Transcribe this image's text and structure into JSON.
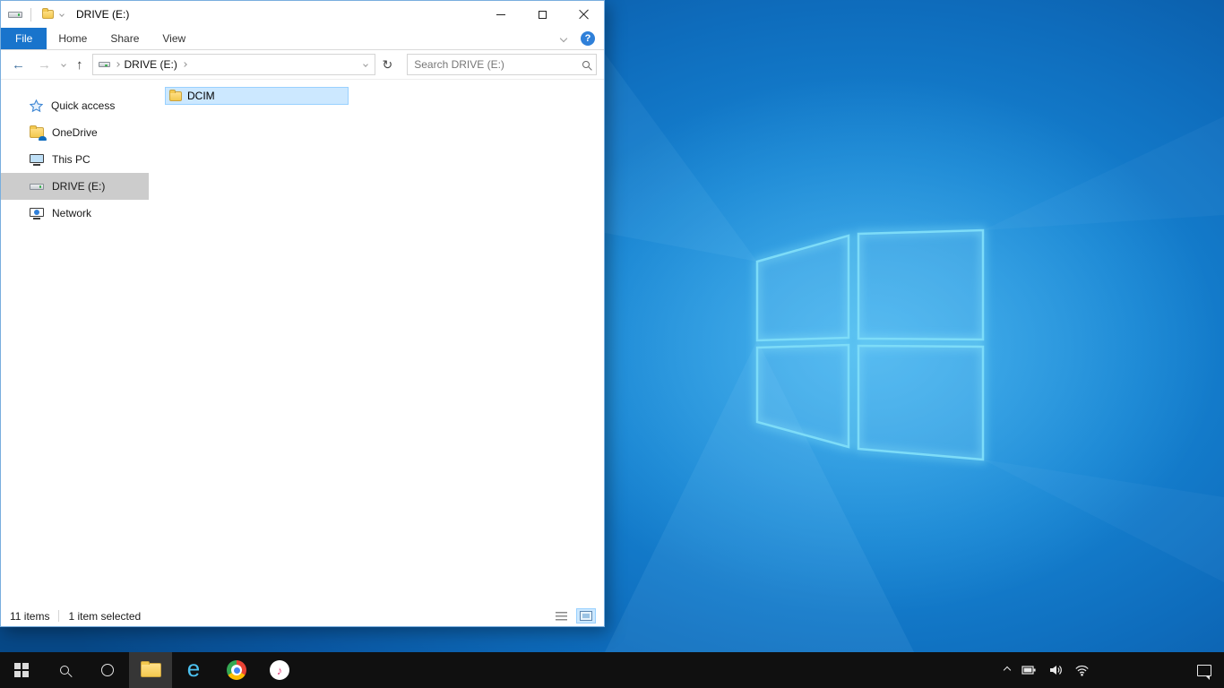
{
  "explorer": {
    "title": "DRIVE (E:)",
    "ribbon": {
      "tabs": [
        {
          "label": "File",
          "active": true
        },
        {
          "label": "Home",
          "active": false
        },
        {
          "label": "Share",
          "active": false
        },
        {
          "label": "View",
          "active": false
        }
      ],
      "help_glyph": "?"
    },
    "navigation": {
      "address_crumb": "DRIVE (E:)",
      "refresh_glyph": "↻",
      "back_glyph": "←",
      "forward_glyph": "→",
      "up_glyph": "↑",
      "search_placeholder": "Search DRIVE (E:)"
    },
    "sidebar": {
      "items": [
        {
          "label": "Quick access",
          "icon": "star-icon",
          "selected": false
        },
        {
          "label": "OneDrive",
          "icon": "folder-cloud-icon",
          "selected": false
        },
        {
          "label": "This PC",
          "icon": "pc-icon",
          "selected": false
        },
        {
          "label": "DRIVE (E:)",
          "icon": "drive-icon",
          "selected": true
        },
        {
          "label": "Network",
          "icon": "network-icon",
          "selected": false
        }
      ]
    },
    "content": {
      "items": [
        {
          "name": "DCIM",
          "icon": "folder-icon",
          "selected": true
        }
      ]
    },
    "statusbar": {
      "item_count": "11 items",
      "selection": "1 item selected"
    }
  },
  "taskbar": {
    "buttons": [
      {
        "name": "start"
      },
      {
        "name": "search"
      },
      {
        "name": "cortana"
      },
      {
        "name": "file-explorer",
        "active": true
      },
      {
        "name": "internet-explorer"
      },
      {
        "name": "chrome"
      },
      {
        "name": "itunes"
      }
    ],
    "ie_glyph": "e",
    "itunes_glyph": "♪"
  },
  "colors": {
    "accent_blue": "#1974cc",
    "selection_fill": "#cce8ff",
    "selection_border": "#99d1ff",
    "sidebar_selected": "#cccccc",
    "taskbar_bg": "#101010",
    "wallpaper_center": "#2d9de6",
    "wallpaper_edge": "#074887",
    "logo_edge": "#7ddcf8"
  }
}
